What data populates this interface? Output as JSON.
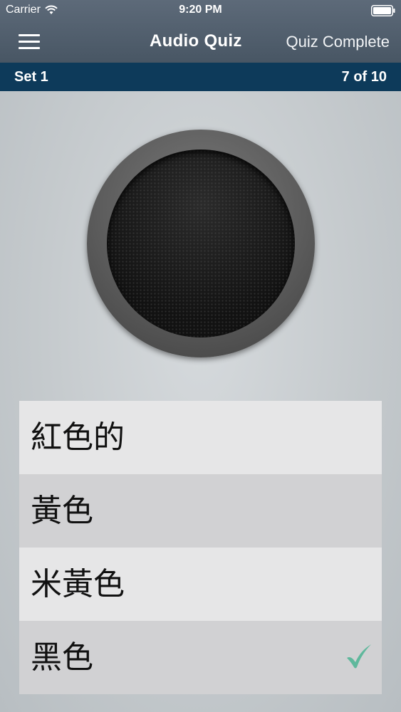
{
  "status": {
    "carrier": "Carrier",
    "time": "9:20 PM"
  },
  "nav": {
    "title": "Audio Quiz",
    "action": "Quiz Complete",
    "menu_icon": "hamburger-menu-icon"
  },
  "set": {
    "label": "Set 1",
    "progress": "7 of 10"
  },
  "answers": [
    {
      "label": "紅色的",
      "selected_correct": false
    },
    {
      "label": "黃色",
      "selected_correct": false
    },
    {
      "label": "米黃色",
      "selected_correct": false
    },
    {
      "label": "黑色",
      "selected_correct": true
    }
  ],
  "colors": {
    "header": "#4f5d6b",
    "set_bar": "#0d3a5a",
    "check": "#5fb89c"
  }
}
